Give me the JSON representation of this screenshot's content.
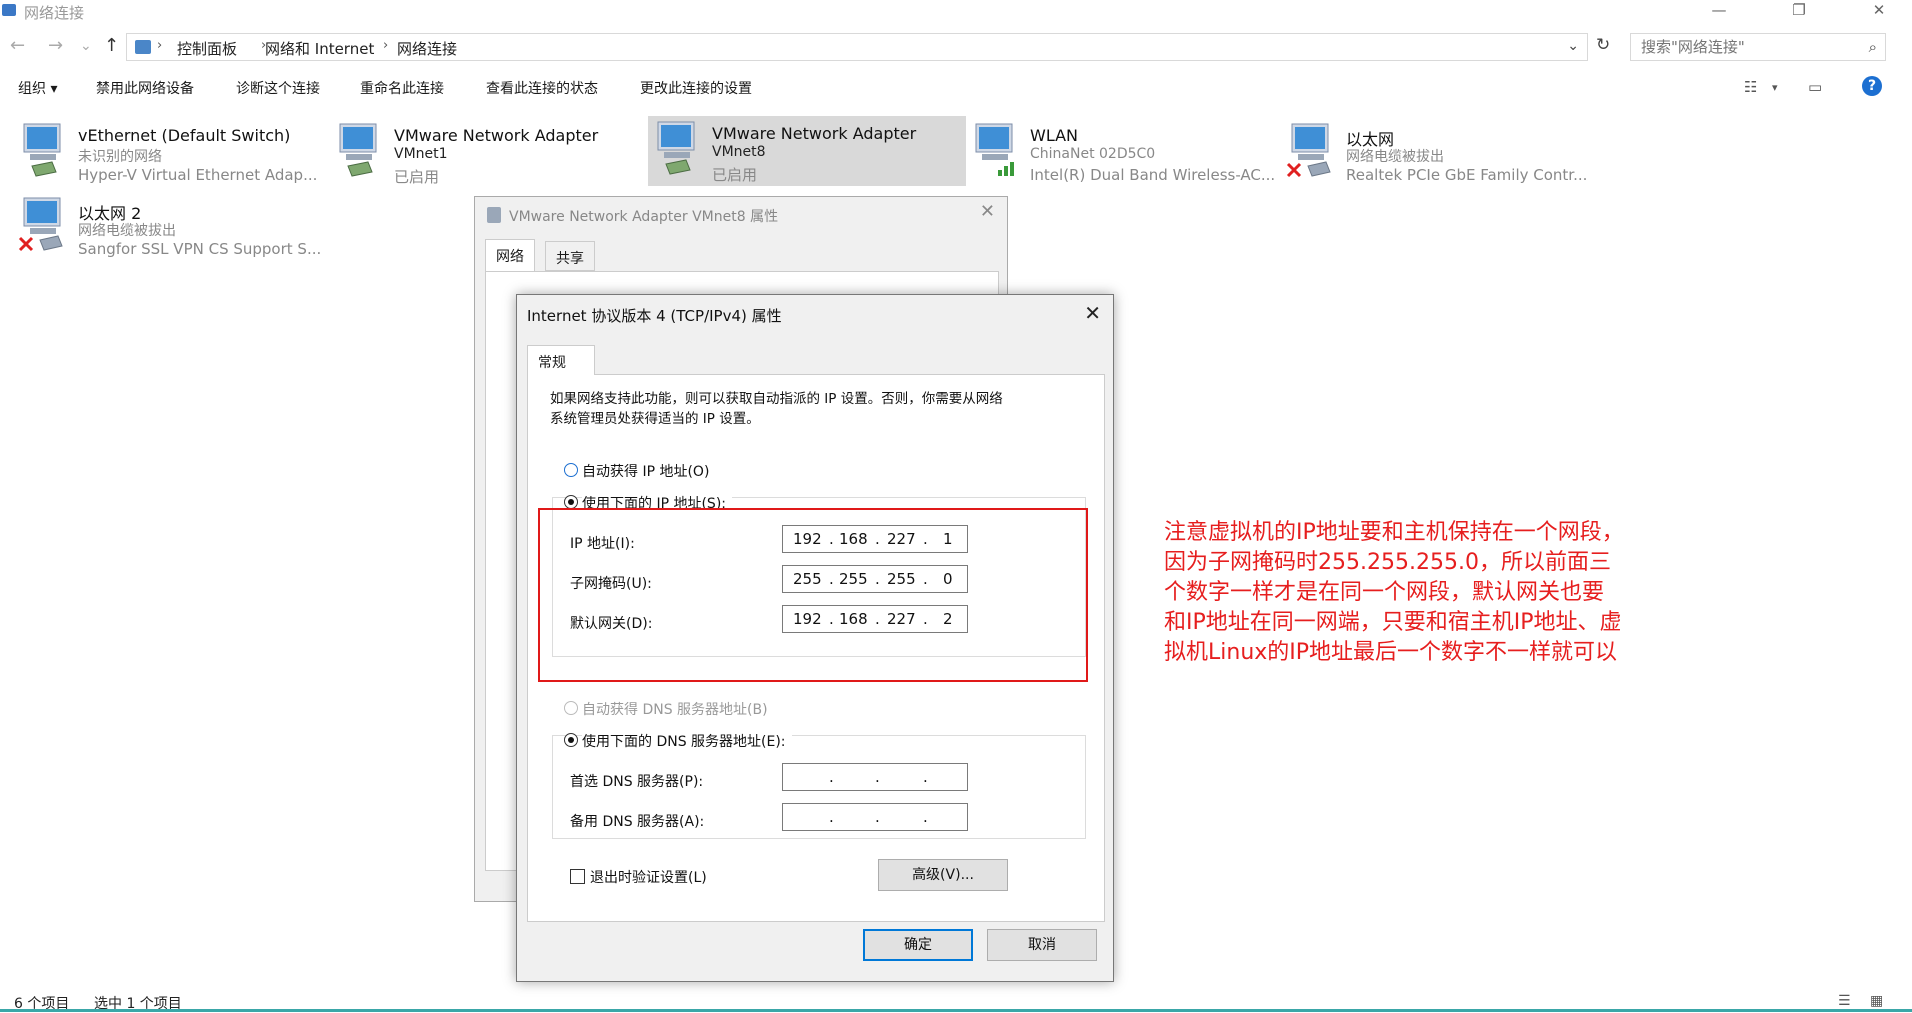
{
  "window": {
    "title": "网络连接",
    "minimize": "—",
    "restore": "❐",
    "close": "✕"
  },
  "address": {
    "back": "←",
    "forward": "→",
    "recent": "⌄",
    "up": "↑",
    "crumbs": [
      "控制面板",
      "网络和 Internet",
      "网络连接"
    ],
    "search_placeholder": "搜索\"网络连接\""
  },
  "commands": [
    "组织 ▾",
    "禁用此网络设备",
    "诊断这个连接",
    "重命名此连接",
    "查看此连接的状态",
    "更改此连接的设置"
  ],
  "adapters": [
    {
      "name": "vEthernet (Default Switch)",
      "status": "未识别的网络",
      "device": "Hyper-V Virtual Ethernet Adap..."
    },
    {
      "name": "VMware Network Adapter",
      "status": "VMnet1",
      "device": "已启用"
    },
    {
      "name": "VMware Network Adapter",
      "status": "VMnet8",
      "device": "已启用"
    },
    {
      "name": "WLAN",
      "status": "ChinaNet 02D5C0",
      "device": "Intel(R) Dual Band Wireless-AC..."
    },
    {
      "name": "以太网",
      "status": "网络电缆被拔出",
      "device": "Realtek PCIe GbE Family Contr..."
    },
    {
      "name": "以太网 2",
      "status": "网络电缆被拔出",
      "device": "Sangfor SSL VPN CS Support S..."
    }
  ],
  "prop_dialog": {
    "title": "VMware Network Adapter VMnet8 属性",
    "tabs": [
      "网络",
      "共享"
    ]
  },
  "ipv4_dialog": {
    "title": "Internet 协议版本 4 (TCP/IPv4) 属性",
    "tab": "常规",
    "intro_line1": "如果网络支持此功能，则可以获取自动指派的 IP 设置。否则，你需要从网络",
    "intro_line2": "系统管理员处获得适当的 IP 设置。",
    "auto_ip": "自动获得 IP 地址(O)",
    "manual_ip": "使用下面的 IP 地址(S):",
    "ip_label": "IP 地址(I):",
    "mask_label": "子网掩码(U):",
    "gateway_label": "默认网关(D):",
    "ip": [
      "192",
      "168",
      "227",
      "1"
    ],
    "mask": [
      "255",
      "255",
      "255",
      "0"
    ],
    "gateway": [
      "192",
      "168",
      "227",
      "2"
    ],
    "auto_dns": "自动获得 DNS 服务器地址(B)",
    "manual_dns": "使用下面的 DNS 服务器地址(E):",
    "dns1_label": "首选 DNS 服务器(P):",
    "dns2_label": "备用 DNS 服务器(A):",
    "validate": "退出时验证设置(L)",
    "advanced": "高级(V)...",
    "ok": "确定",
    "cancel": "取消"
  },
  "annotation": "注意虚拟机的IP地址要和主机保持在一个网段，因为子网掩码时255.255.255.0，所以前面三个数字一样才是在同一个网段，默认网关也要和IP地址在同一网端，只要和宿主机IP地址、虚拟机Linux的IP地址最后一个数字不一样就可以",
  "status": {
    "count": "6 个项目",
    "selected": "选中 1 个项目"
  },
  "colors": {
    "accent": "#0078d7",
    "annotation": "#e61e1e",
    "highlight_box": "#e01919"
  }
}
